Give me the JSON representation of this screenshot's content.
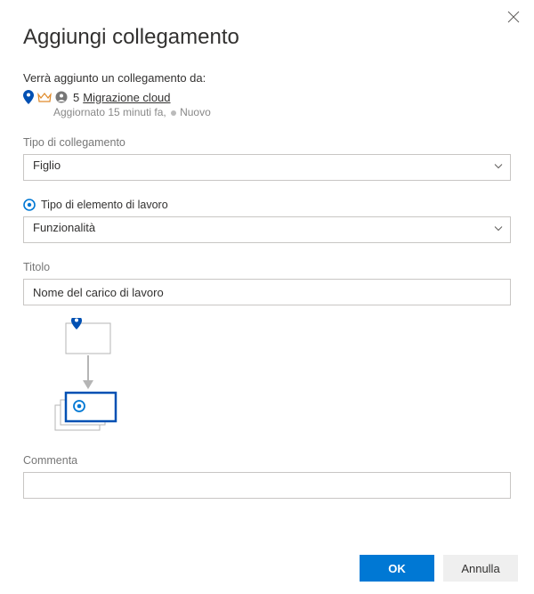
{
  "dialog": {
    "title": "Aggiungi collegamento",
    "intro": "Verrà aggiunto un collegamento da:"
  },
  "source": {
    "id": "5",
    "title": "Migrazione cloud",
    "updated_prefix": "Aggiornato 15 minuti fa,",
    "status": "Nuovo"
  },
  "link_type": {
    "label": "Tipo di collegamento",
    "value": "Figlio"
  },
  "work_item_type": {
    "label": "Tipo di elemento di lavoro",
    "value": "Funzionalità"
  },
  "title_field": {
    "label": "Titolo",
    "value": "Nome del carico di lavoro"
  },
  "comment": {
    "label": "Commenta",
    "value": ""
  },
  "buttons": {
    "ok": "OK",
    "cancel": "Annulla"
  },
  "colors": {
    "accent": "#0078d4",
    "feature_color": "#0050b3",
    "crown": "#e08a2a"
  }
}
